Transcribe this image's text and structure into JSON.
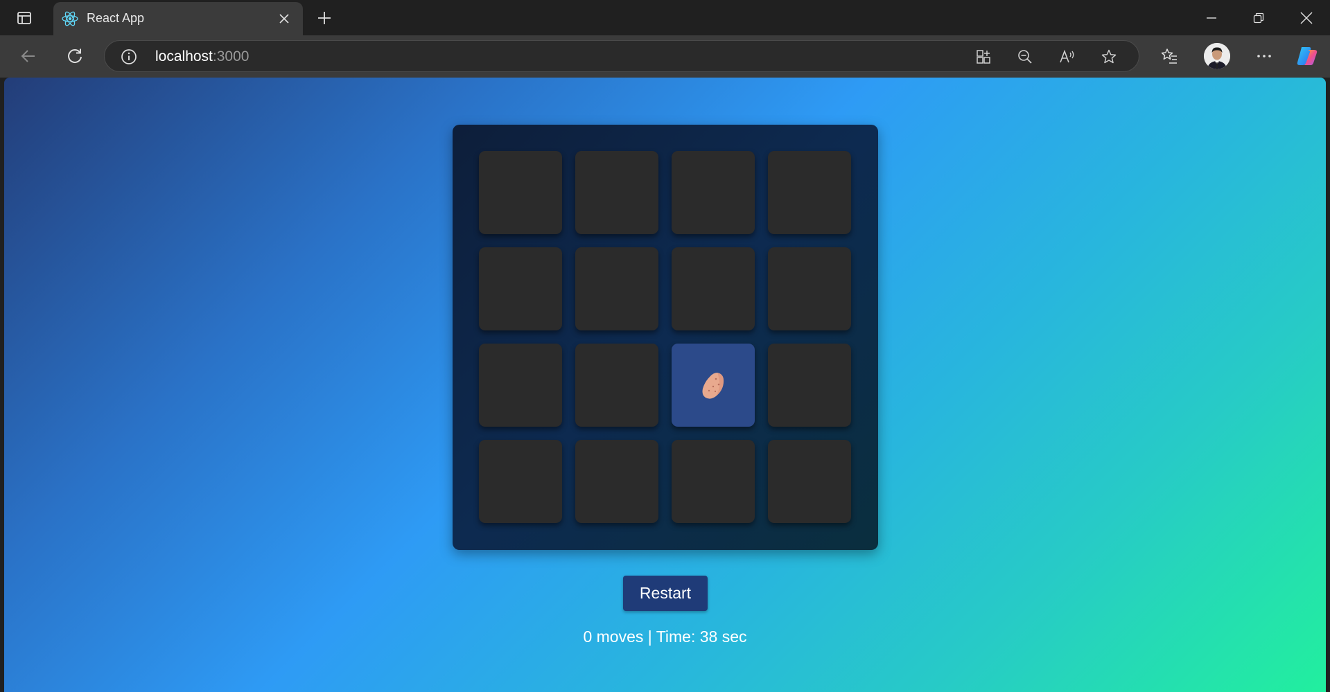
{
  "browser": {
    "tab_title": "React App",
    "url_host": "localhost",
    "url_port": ":3000"
  },
  "icons": {
    "tab_actions": "tab-actions-icon",
    "favicon": "react-icon",
    "close": "close-icon",
    "new_tab": "plus-icon",
    "minimize": "minimize-icon",
    "restore": "restore-icon",
    "close_window": "close-icon",
    "back": "back-arrow-icon",
    "refresh": "refresh-icon",
    "site_info": "info-icon",
    "app_available": "app-grid-icon",
    "zoom_out": "zoom-out-icon",
    "read_aloud": "read-aloud-icon",
    "favorite": "star-icon",
    "favorites": "favorites-list-icon",
    "more": "more-icon",
    "copilot": "copilot-icon"
  },
  "game": {
    "cards": [
      {
        "state": "hidden"
      },
      {
        "state": "hidden"
      },
      {
        "state": "hidden"
      },
      {
        "state": "hidden"
      },
      {
        "state": "hidden"
      },
      {
        "state": "hidden"
      },
      {
        "state": "hidden"
      },
      {
        "state": "hidden"
      },
      {
        "state": "hidden"
      },
      {
        "state": "hidden"
      },
      {
        "state": "flipped",
        "content": "🥔"
      },
      {
        "state": "hidden"
      },
      {
        "state": "hidden"
      },
      {
        "state": "hidden"
      },
      {
        "state": "hidden"
      },
      {
        "state": "hidden"
      }
    ],
    "restart_label": "Restart",
    "stats_text": "0 moves | Time: 38 sec"
  },
  "colors": {
    "card_hidden": "#2b2b2b",
    "card_flipped": "#2c4a8a",
    "button": "#1f3b78"
  }
}
